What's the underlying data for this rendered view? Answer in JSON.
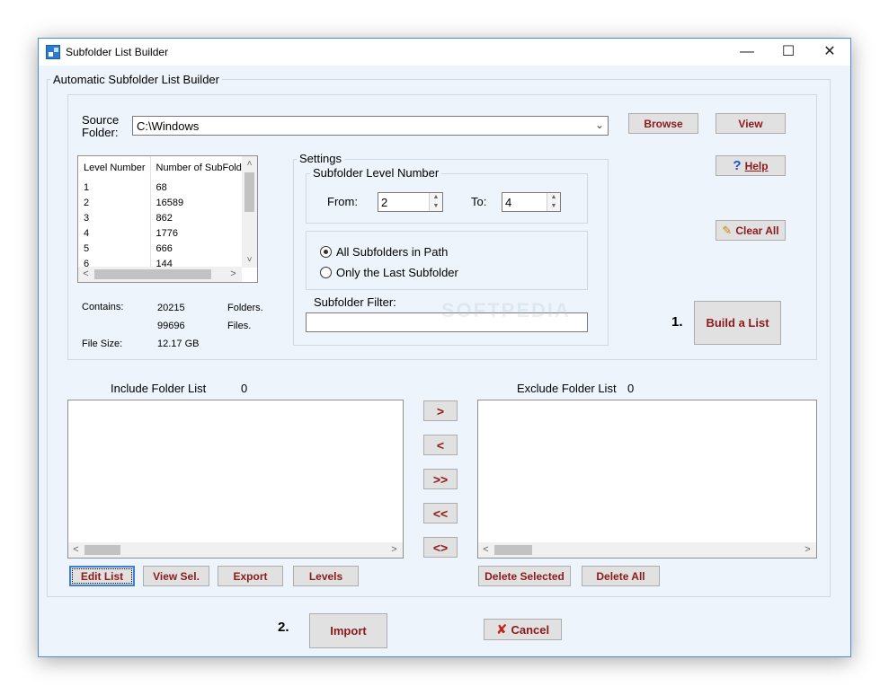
{
  "window": {
    "title": "Subfolder List Builder",
    "minimize": "—",
    "maximize": "☐",
    "close": "✕"
  },
  "main_group": {
    "title": "Automatic Subfolder List Builder"
  },
  "source": {
    "label_line1": "Source",
    "label_line2": "Folder:",
    "value": "C:\\Windows",
    "browse": "Browse",
    "view": "View"
  },
  "levels_table": {
    "headers": [
      "Level Number",
      "Number of SubFolde"
    ],
    "rows": [
      [
        "1",
        "68"
      ],
      [
        "2",
        "16589"
      ],
      [
        "3",
        "862"
      ],
      [
        "4",
        "1776"
      ],
      [
        "5",
        "666"
      ],
      [
        "6",
        "144"
      ]
    ]
  },
  "stats": {
    "contains_label": "Contains:",
    "folders_count": "20215",
    "folders_label": "Folders.",
    "files_count": "99696",
    "files_label": "Files.",
    "size_label": "File Size:",
    "size_value": "12.17 GB"
  },
  "settings": {
    "title": "Settings",
    "level_group": "Subfolder Level Number",
    "from_label": "From:",
    "from_value": "2",
    "to_label": "To:",
    "to_value": "4",
    "radio_all": "All Subfolders in Path",
    "radio_last": "Only the Last Subfolder",
    "radio_selected": "all",
    "filter_label": "Subfolder Filter:",
    "filter_value": ""
  },
  "right_buttons": {
    "help": "Help",
    "clear_all": "Clear All",
    "step1": "1.",
    "build": "Build a List"
  },
  "include": {
    "label": "Include Folder List",
    "count": "0"
  },
  "exclude": {
    "label": "Exclude Folder List",
    "count": "0"
  },
  "transfer": {
    "move_right": ">",
    "move_left": "<",
    "move_all_right": ">>",
    "move_all_left": "<<",
    "swap": "<>"
  },
  "include_buttons": {
    "edit": "Edit List",
    "view_sel": "View Sel.",
    "export": "Export",
    "levels": "Levels"
  },
  "exclude_buttons": {
    "delete_selected": "Delete Selected",
    "delete_all": "Delete All"
  },
  "bottom": {
    "step2": "2.",
    "import": "Import",
    "cancel": "Cancel"
  },
  "watermark": "SOFTPEDIA",
  "colors": {
    "accent_text": "#8b1a1a",
    "window_bg": "#edf4fc",
    "border_blue": "#4a8bd6"
  }
}
